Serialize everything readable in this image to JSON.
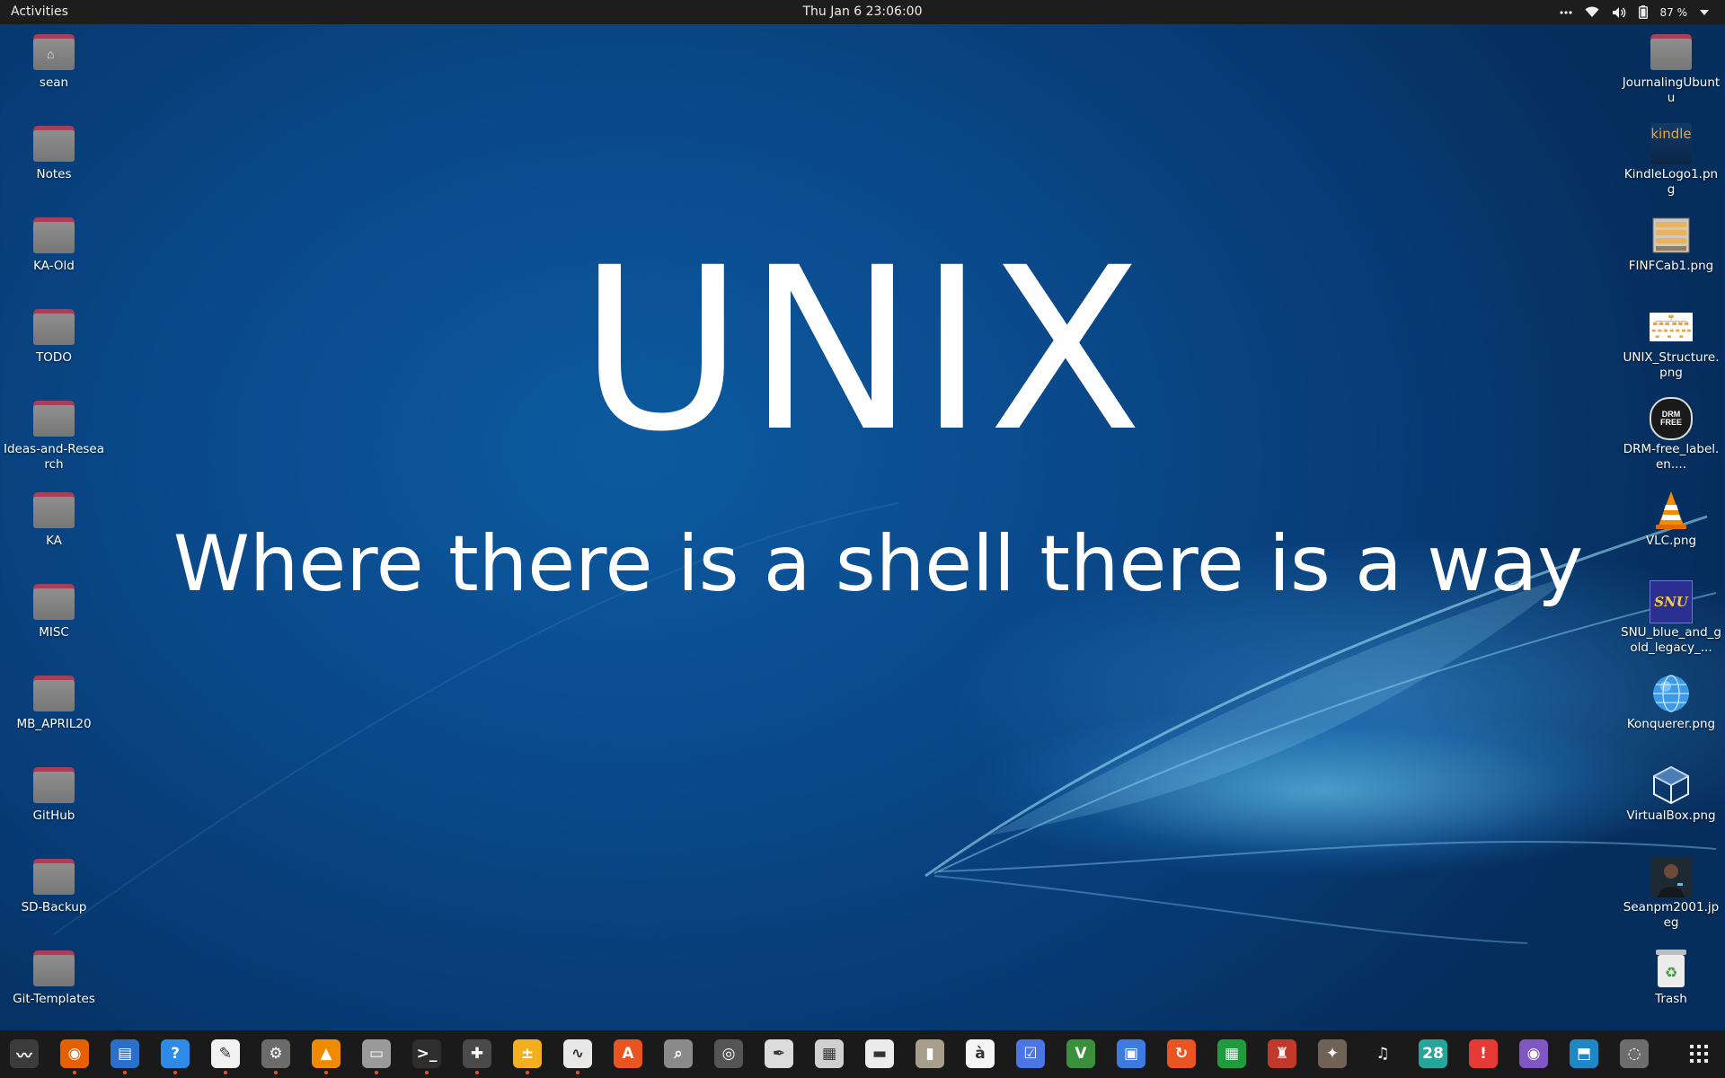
{
  "topbar": {
    "activities": "Activities",
    "clock": "Thu Jan 6  23:06:00",
    "battery": "87 %",
    "tray_icons": [
      "more-icon",
      "wifi-icon",
      "volume-icon",
      "battery-icon",
      "chevron-down-icon"
    ]
  },
  "wallpaper": {
    "title": "UNIX",
    "subtitle": "Where there is a shell there is a way"
  },
  "desktop_left": [
    {
      "label": "sean",
      "icon": "home-folder-icon"
    },
    {
      "label": "Notes",
      "icon": "folder-icon"
    },
    {
      "label": "KA-Old",
      "icon": "folder-icon"
    },
    {
      "label": "TODO",
      "icon": "folder-icon"
    },
    {
      "label": "Ideas-and-Research",
      "icon": "folder-icon"
    },
    {
      "label": "KA",
      "icon": "folder-icon"
    },
    {
      "label": "MISC",
      "icon": "folder-icon"
    },
    {
      "label": "MB_APRIL20",
      "icon": "folder-icon"
    },
    {
      "label": "GitHub",
      "icon": "folder-icon"
    },
    {
      "label": "SD-Backup",
      "icon": "folder-icon"
    },
    {
      "label": "Git-Templates",
      "icon": "folder-icon"
    }
  ],
  "desktop_right": [
    {
      "label": "JournalingUbuntu",
      "icon": "folder-icon"
    },
    {
      "label": "KindleLogo1.png",
      "icon": "kindle-image-icon",
      "thumb_text": "kindle"
    },
    {
      "label": "FINFCab1.png",
      "icon": "file-cabinet-image-icon"
    },
    {
      "label": "UNIX_Structure.png",
      "icon": "diagram-image-icon"
    },
    {
      "label": "DRM-free_label.en....",
      "icon": "drm-free-image-icon",
      "thumb_text": "DRM FREE"
    },
    {
      "label": "VLC.png",
      "icon": "vlc-cone-image-icon"
    },
    {
      "label": "SNU_blue_and_gold_legacy_...",
      "icon": "snu-logo-image-icon",
      "thumb_text": "SNU"
    },
    {
      "label": "Konquerer.png",
      "icon": "globe-image-icon"
    },
    {
      "label": "VirtualBox.png",
      "icon": "virtualbox-image-icon"
    },
    {
      "label": "Seanpm2001.jpeg",
      "icon": "photo-image-icon"
    },
    {
      "label": "Trash",
      "icon": "trash-icon"
    }
  ],
  "dock": [
    {
      "name": "system-monitor-icon",
      "glyph": "〰",
      "color": "#3b3b3b",
      "running": false
    },
    {
      "name": "firefox-icon",
      "glyph": "◉",
      "color": "#e66000",
      "running": true
    },
    {
      "name": "writer-icon",
      "glyph": "▤",
      "color": "#2a6fc9",
      "running": true
    },
    {
      "name": "help-icon",
      "glyph": "?",
      "color": "#2d8ae6",
      "running": true
    },
    {
      "name": "text-editor-icon",
      "glyph": "✎",
      "color": "#f2f2f2",
      "running": true
    },
    {
      "name": "settings-icon",
      "glyph": "⚙",
      "color": "#6b6b6b",
      "running": true
    },
    {
      "name": "vlc-icon",
      "glyph": "▲",
      "color": "#f08a00",
      "running": true
    },
    {
      "name": "files-icon",
      "glyph": "▭",
      "color": "#9a9a9a",
      "running": true
    },
    {
      "name": "terminal-icon",
      "glyph": ">_",
      "color": "#2e2e2e",
      "running": true
    },
    {
      "name": "extensions-icon",
      "glyph": "✚",
      "color": "#4a4a4a",
      "running": true
    },
    {
      "name": "calculator-icon",
      "glyph": "±",
      "color": "#f2b01e",
      "running": true
    },
    {
      "name": "system-monitor-graph-icon",
      "glyph": "∿",
      "color": "#e8e8e8",
      "running": true
    },
    {
      "name": "app-center-icon",
      "glyph": "A",
      "color": "#e95420",
      "running": false
    },
    {
      "name": "image-viewer-icon",
      "glyph": "⌕",
      "color": "#8a8a8a",
      "running": false
    },
    {
      "name": "disk-usage-icon",
      "glyph": "◎",
      "color": "#555555",
      "running": false
    },
    {
      "name": "dictionary-icon",
      "glyph": "✒",
      "color": "#dcdcdc",
      "running": false
    },
    {
      "name": "document-scanner-icon",
      "glyph": "▦",
      "color": "#d0d0d0",
      "running": false
    },
    {
      "name": "document-viewer-icon",
      "glyph": "▬",
      "color": "#ececec",
      "running": false
    },
    {
      "name": "archive-manager-icon",
      "glyph": "▮",
      "color": "#a89e8c",
      "running": false
    },
    {
      "name": "character-map-icon",
      "glyph": "à",
      "color": "#f5f5f5",
      "running": false
    },
    {
      "name": "tasks-icon",
      "glyph": "☑",
      "color": "#4a76e8",
      "running": false
    },
    {
      "name": "vim-icon",
      "glyph": "V",
      "color": "#3a8f3a",
      "running": false
    },
    {
      "name": "remote-desktop-icon",
      "glyph": "▣",
      "color": "#3d7be0",
      "running": false
    },
    {
      "name": "update-manager-icon",
      "glyph": "↻",
      "color": "#e95420",
      "running": false
    },
    {
      "name": "spreadsheet-icon",
      "glyph": "▦",
      "color": "#1f9a3c",
      "running": false
    },
    {
      "name": "mario-game-icon",
      "glyph": "♜",
      "color": "#c0392b",
      "running": false
    },
    {
      "name": "gimp-icon",
      "glyph": "✦",
      "color": "#6e6356",
      "running": false
    },
    {
      "name": "music-icon",
      "glyph": "♫",
      "color": "#1a1a1a",
      "running": false
    },
    {
      "name": "calendar-icon",
      "glyph": "28",
      "color": "#26a69a",
      "running": false
    },
    {
      "name": "alert-icon",
      "glyph": "!",
      "color": "#e53935",
      "running": false
    },
    {
      "name": "screenshot-icon",
      "glyph": "◉",
      "color": "#7e57c2",
      "running": false
    },
    {
      "name": "virtualbox-icon",
      "glyph": "⬒",
      "color": "#1e88c7",
      "running": false
    },
    {
      "name": "ubuntu-software-icon",
      "glyph": "◌",
      "color": "#6d6d6d",
      "running": false
    }
  ],
  "dock_apps_grid": "show-applications-icon"
}
